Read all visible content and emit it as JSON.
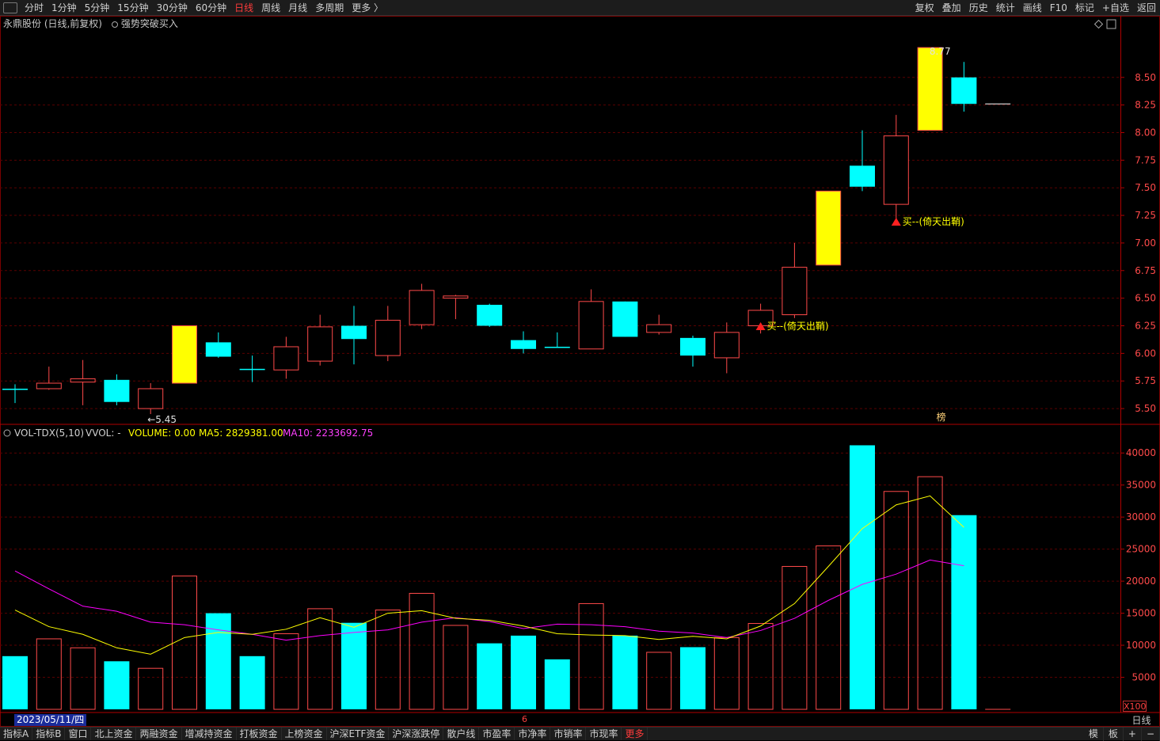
{
  "toolbar": {
    "periods": [
      "分时",
      "1分钟",
      "5分钟",
      "15分钟",
      "30分钟",
      "60分钟",
      "日线",
      "周线",
      "月线",
      "多周期",
      "更多 〉"
    ],
    "active_period": "日线",
    "right_buttons": [
      "复权",
      "叠加",
      "历史",
      "统计",
      "画线",
      "F10",
      "标记",
      "+自选",
      "返回"
    ]
  },
  "info": {
    "title": "永鼎股份 (日线,前复权)",
    "strategy": "强势突破买入"
  },
  "price_axis": {
    "ticks": [
      "8.50",
      "8.25",
      "8.00",
      "7.75",
      "7.50",
      "7.25",
      "7.00",
      "6.75",
      "6.50",
      "6.25",
      "6.00",
      "5.75",
      "5.50"
    ],
    "high_label": "8.77",
    "low_label": "←5.45",
    "bang_label": "榜"
  },
  "signals": [
    {
      "text": "买--(倚天出鞘)"
    },
    {
      "text": "买--(倚天出鞘)"
    }
  ],
  "volume_header": {
    "name": "VOL-TDX(5,10)",
    "vvol": "VVOL: -",
    "volume": "VOLUME: 0.00",
    "ma5": "MA5: 2829381.00",
    "ma10": "MA10: 2233692.75"
  },
  "volume_axis": {
    "ticks": [
      "40000",
      "35000",
      "30000",
      "25000",
      "20000",
      "15000",
      "10000",
      "5000"
    ],
    "unit": "X100"
  },
  "footer": {
    "date": "2023/05/11/四",
    "month_mark": "6",
    "period": "日线",
    "tabs": [
      "指标A",
      "指标B",
      "窗口",
      "北上资金",
      "两融资金",
      "增减持资金",
      "打板资金",
      "上榜资金",
      "沪深ETF资金",
      "沪深涨跌停",
      "散户线",
      "市盈率",
      "市净率",
      "市销率",
      "市现率",
      "更多"
    ],
    "right": [
      "模",
      "板",
      "+",
      "−"
    ]
  },
  "colors": {
    "up": "#ff4a4a",
    "down": "#00ffff",
    "limit_up": "#ffff00",
    "ma5": "#ffff00",
    "ma10": "#ff00ff",
    "grid": "#5a0000",
    "axis_text": "#ff4a4a"
  },
  "chart_data": {
    "type": "candlestick",
    "candles": [
      {
        "o": 5.68,
        "h": 5.72,
        "l": 5.55,
        "c": 5.67,
        "kind": "down"
      },
      {
        "o": 5.68,
        "h": 5.88,
        "l": 5.67,
        "c": 5.73,
        "kind": "up"
      },
      {
        "o": 5.74,
        "h": 5.94,
        "l": 5.53,
        "c": 5.77,
        "kind": "up"
      },
      {
        "o": 5.76,
        "h": 5.81,
        "l": 5.53,
        "c": 5.56,
        "kind": "down"
      },
      {
        "o": 5.5,
        "h": 5.73,
        "l": 5.45,
        "c": 5.68,
        "kind": "up"
      },
      {
        "o": 5.73,
        "h": 6.25,
        "l": 5.73,
        "c": 6.25,
        "kind": "limit"
      },
      {
        "o": 6.1,
        "h": 6.19,
        "l": 5.96,
        "c": 5.97,
        "kind": "down"
      },
      {
        "o": 5.86,
        "h": 5.98,
        "l": 5.74,
        "c": 5.85,
        "kind": "down"
      },
      {
        "o": 5.85,
        "h": 6.15,
        "l": 5.77,
        "c": 6.06,
        "kind": "up"
      },
      {
        "o": 5.93,
        "h": 6.35,
        "l": 5.89,
        "c": 6.24,
        "kind": "up"
      },
      {
        "o": 6.25,
        "h": 6.43,
        "l": 5.9,
        "c": 6.13,
        "kind": "down"
      },
      {
        "o": 5.98,
        "h": 6.43,
        "l": 5.93,
        "c": 6.3,
        "kind": "up"
      },
      {
        "o": 6.26,
        "h": 6.63,
        "l": 6.22,
        "c": 6.57,
        "kind": "up"
      },
      {
        "o": 6.5,
        "h": 6.53,
        "l": 6.31,
        "c": 6.52,
        "kind": "up"
      },
      {
        "o": 6.44,
        "h": 6.45,
        "l": 6.24,
        "c": 6.25,
        "kind": "down"
      },
      {
        "o": 6.12,
        "h": 6.2,
        "l": 6.0,
        "c": 6.04,
        "kind": "down"
      },
      {
        "o": 6.06,
        "h": 6.19,
        "l": 6.05,
        "c": 6.05,
        "kind": "down"
      },
      {
        "o": 6.04,
        "h": 6.58,
        "l": 6.04,
        "c": 6.47,
        "kind": "up"
      },
      {
        "o": 6.47,
        "h": 6.47,
        "l": 6.15,
        "c": 6.15,
        "kind": "down"
      },
      {
        "o": 6.19,
        "h": 6.35,
        "l": 6.17,
        "c": 6.26,
        "kind": "up"
      },
      {
        "o": 6.14,
        "h": 6.16,
        "l": 5.88,
        "c": 5.98,
        "kind": "down"
      },
      {
        "o": 5.96,
        "h": 6.28,
        "l": 5.82,
        "c": 6.19,
        "kind": "up"
      },
      {
        "o": 6.25,
        "h": 6.45,
        "l": 6.18,
        "c": 6.39,
        "kind": "up"
      },
      {
        "o": 6.35,
        "h": 7.0,
        "l": 6.32,
        "c": 6.78,
        "kind": "up"
      },
      {
        "o": 6.8,
        "h": 7.47,
        "l": 6.8,
        "c": 7.47,
        "kind": "limit"
      },
      {
        "o": 7.7,
        "h": 8.02,
        "l": 7.47,
        "c": 7.51,
        "kind": "down"
      },
      {
        "o": 7.35,
        "h": 8.16,
        "l": 7.17,
        "c": 7.97,
        "kind": "up"
      },
      {
        "o": 8.02,
        "h": 8.77,
        "l": 8.02,
        "c": 8.77,
        "kind": "limit"
      },
      {
        "o": 8.5,
        "h": 8.64,
        "l": 8.19,
        "c": 8.26,
        "kind": "down"
      },
      {
        "o": 8.26,
        "h": 8.26,
        "l": 8.26,
        "c": 8.26,
        "kind": "flat"
      }
    ],
    "volumes": [
      8300,
      11000,
      9600,
      7500,
      6400,
      20800,
      15000,
      8300,
      11800,
      15700,
      13500,
      15500,
      18100,
      13100,
      10300,
      11500,
      7800,
      16500,
      11500,
      8900,
      9700,
      11200,
      13400,
      22300,
      25500,
      41200,
      34000,
      36300,
      30300,
      0
    ],
    "ma5": [
      15500,
      12900,
      11700,
      9600,
      8600,
      11200,
      12000,
      11700,
      12500,
      14300,
      12800,
      15000,
      15400,
      14200,
      13900,
      13000,
      11800,
      11600,
      11500,
      10900,
      11400,
      11000,
      13000,
      16500,
      22300,
      28200,
      31900,
      33300,
      28400
    ],
    "ma10": [
      21600,
      18800,
      16100,
      15300,
      13600,
      13200,
      12400,
      11700,
      10800,
      11500,
      12000,
      12400,
      13600,
      14300,
      13700,
      12600,
      13300,
      13200,
      12900,
      12200,
      11900,
      11200,
      12300,
      14200,
      17000,
      19500,
      21100,
      23300,
      22400
    ],
    "price_ylim": [
      5.35,
      8.95
    ],
    "volume_ylim": [
      0,
      42000
    ]
  }
}
